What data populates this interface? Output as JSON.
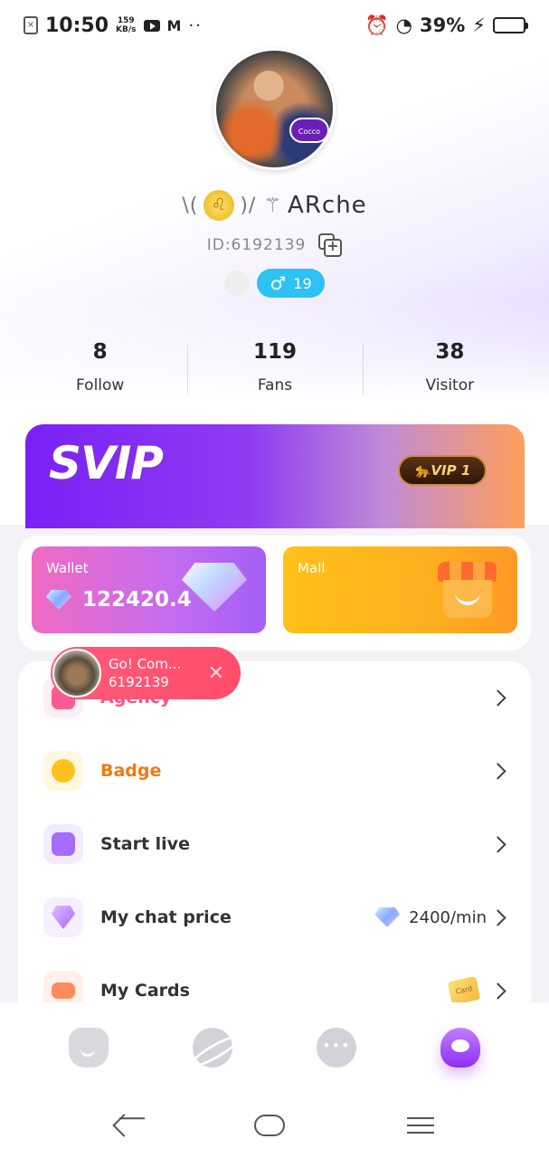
{
  "status_bar": {
    "time": "10:50",
    "speed_value": "159",
    "speed_unit": "KB/s",
    "battery": "39%"
  },
  "profile": {
    "name": "ARche",
    "id_text": "ID:6192139",
    "age": "19",
    "gender_symbol": "♂",
    "avatar_badge": "Cocco"
  },
  "stats": [
    {
      "value": "8",
      "label": "Follow"
    },
    {
      "value": "119",
      "label": "Fans"
    },
    {
      "value": "38",
      "label": "Visitor"
    }
  ],
  "svip": {
    "title": "SVIP",
    "vip_badge": "VIP 1"
  },
  "wallet": {
    "label": "Wallet",
    "amount": "122420.4"
  },
  "mall": {
    "label": "Mall"
  },
  "floating_notice": {
    "title": "Go! Com...",
    "id": "6192139"
  },
  "menu": {
    "agency": "Agency",
    "badge": "Badge",
    "start_live": "Start live",
    "chat_price": "My chat price",
    "chat_price_value": "2400/min",
    "cards": "My Cards",
    "card_tag": "Card"
  },
  "colors": {
    "accent_purple": "#8c2ff2",
    "gender_blue": "#2ec1f4",
    "badge_orange": "#f07a10",
    "agency_pink": "#ff4d8d"
  }
}
